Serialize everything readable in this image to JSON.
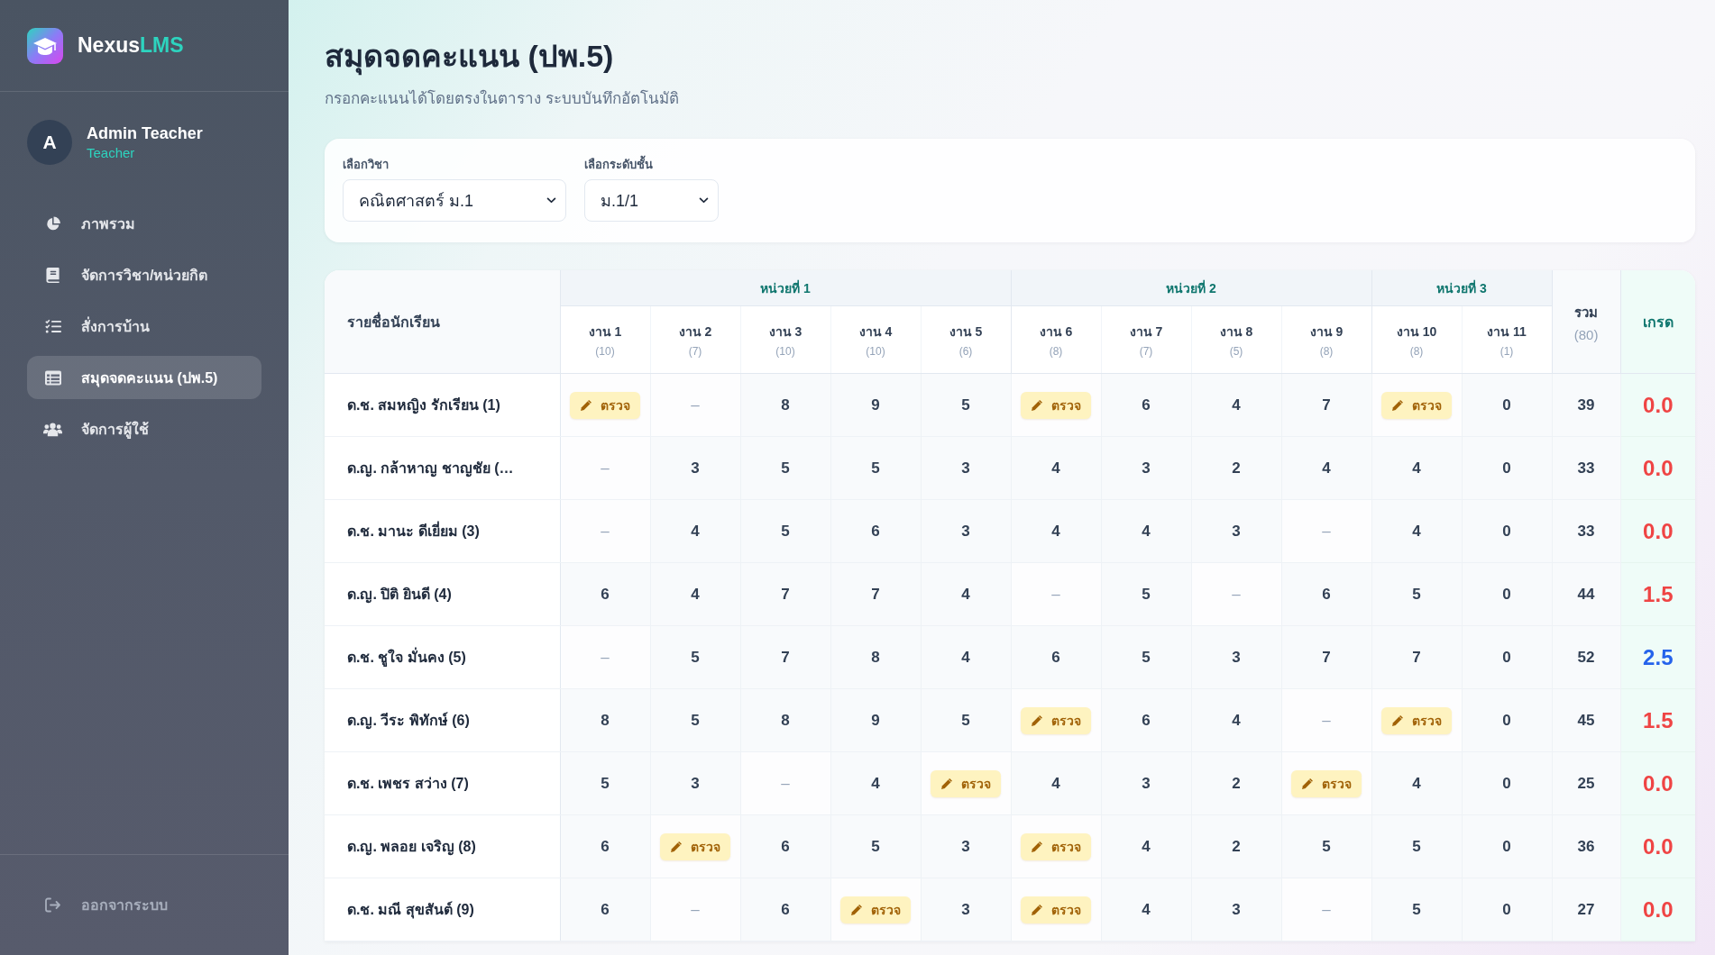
{
  "sidebar": {
    "brand": {
      "name": "Nexus",
      "accent": "LMS"
    },
    "user": {
      "initial": "A",
      "name": "Admin Teacher",
      "role": "Teacher"
    },
    "nav": [
      {
        "label": "ภาพรวม",
        "selected": false
      },
      {
        "label": "จัดการวิชา/หน่วยกิต",
        "selected": false
      },
      {
        "label": "สั่งการบ้าน",
        "selected": false
      },
      {
        "label": "สมุดจดคะแนน (ปพ.5)",
        "selected": true
      },
      {
        "label": "จัดการผู้ใช้",
        "selected": false
      }
    ],
    "logout": "ออกจากระบบ"
  },
  "header": {
    "title": "สมุดจดคะแนน (ปพ.5)",
    "subtitle": "กรอกคะแนนได้โดยตรงในตาราง ระบบบันทึกอัตโนมัติ"
  },
  "filters": [
    {
      "label": "เลือกวิชา",
      "value": "คณิตศาสตร์ ม.1"
    },
    {
      "label": "เลือกระดับชั้น",
      "value": "ม.1/1"
    }
  ],
  "table": {
    "student_header": "รายชื่อนักเรียน",
    "units": [
      {
        "label": "หน่วยที่ 1",
        "tasks": [
          {
            "label": "งาน 1",
            "max": "(10)"
          },
          {
            "label": "งาน 2",
            "max": "(7)"
          },
          {
            "label": "งาน 3",
            "max": "(10)"
          },
          {
            "label": "งาน 4",
            "max": "(10)"
          },
          {
            "label": "งาน 5",
            "max": "(6)"
          }
        ]
      },
      {
        "label": "หน่วยที่ 2",
        "tasks": [
          {
            "label": "งาน 6",
            "max": "(8)"
          },
          {
            "label": "งาน 7",
            "max": "(7)"
          },
          {
            "label": "งาน 8",
            "max": "(5)"
          },
          {
            "label": "งาน 9",
            "max": "(8)"
          }
        ]
      },
      {
        "label": "หน่วยที่ 3",
        "tasks": [
          {
            "label": "งาน 10",
            "max": "(8)"
          },
          {
            "label": "งาน 11",
            "max": "(1)"
          }
        ]
      }
    ],
    "total_header": {
      "label": "รวม",
      "max": "(80)"
    },
    "grade_header": "เกรด",
    "rows": [
      {
        "name": "ด.ช. สมหญิง รักเรียน (1)",
        "cells": [
          {
            "kind": "pending",
            "text": "ตรวจ"
          },
          {
            "kind": "missing",
            "text": "–"
          },
          {
            "kind": "score",
            "text": "8"
          },
          {
            "kind": "score",
            "text": "9"
          },
          {
            "kind": "score",
            "text": "5"
          },
          {
            "kind": "pending",
            "text": "ตรวจ"
          },
          {
            "kind": "score",
            "text": "6"
          },
          {
            "kind": "score",
            "text": "4"
          },
          {
            "kind": "score",
            "text": "7"
          },
          {
            "kind": "pending",
            "text": "ตรวจ"
          },
          {
            "kind": "score",
            "text": "0"
          }
        ],
        "total": "39",
        "grade": {
          "text": "0.0",
          "color": "#ef4444"
        }
      },
      {
        "name": "ด.ญ. กล้าหาญ ชาญชัย (…",
        "cells": [
          {
            "kind": "missing",
            "text": "–"
          },
          {
            "kind": "score",
            "text": "3"
          },
          {
            "kind": "score",
            "text": "5"
          },
          {
            "kind": "score",
            "text": "5"
          },
          {
            "kind": "score",
            "text": "3"
          },
          {
            "kind": "score",
            "text": "4"
          },
          {
            "kind": "score",
            "text": "3"
          },
          {
            "kind": "score",
            "text": "2"
          },
          {
            "kind": "score",
            "text": "4"
          },
          {
            "kind": "score",
            "text": "4"
          },
          {
            "kind": "score",
            "text": "0"
          }
        ],
        "total": "33",
        "grade": {
          "text": "0.0",
          "color": "#ef4444"
        }
      },
      {
        "name": "ด.ช. มานะ ดีเยี่ยม (3)",
        "cells": [
          {
            "kind": "missing",
            "text": "–"
          },
          {
            "kind": "score",
            "text": "4"
          },
          {
            "kind": "score",
            "text": "5"
          },
          {
            "kind": "score",
            "text": "6"
          },
          {
            "kind": "score",
            "text": "3"
          },
          {
            "kind": "score",
            "text": "4"
          },
          {
            "kind": "score",
            "text": "4"
          },
          {
            "kind": "score",
            "text": "3"
          },
          {
            "kind": "missing",
            "text": "–"
          },
          {
            "kind": "score",
            "text": "4"
          },
          {
            "kind": "score",
            "text": "0"
          }
        ],
        "total": "33",
        "grade": {
          "text": "0.0",
          "color": "#ef4444"
        }
      },
      {
        "name": "ด.ญ. ปิติ ยินดี (4)",
        "cells": [
          {
            "kind": "score",
            "text": "6"
          },
          {
            "kind": "score",
            "text": "4"
          },
          {
            "kind": "score",
            "text": "7"
          },
          {
            "kind": "score",
            "text": "7"
          },
          {
            "kind": "score",
            "text": "4"
          },
          {
            "kind": "missing",
            "text": "–"
          },
          {
            "kind": "score",
            "text": "5"
          },
          {
            "kind": "missing",
            "text": "–"
          },
          {
            "kind": "score",
            "text": "6"
          },
          {
            "kind": "score",
            "text": "5"
          },
          {
            "kind": "score",
            "text": "0"
          }
        ],
        "total": "44",
        "grade": {
          "text": "1.5",
          "color": "#ef4444"
        }
      },
      {
        "name": "ด.ช. ชูใจ มั่นคง (5)",
        "cells": [
          {
            "kind": "missing",
            "text": "–"
          },
          {
            "kind": "score",
            "text": "5"
          },
          {
            "kind": "score",
            "text": "7"
          },
          {
            "kind": "score",
            "text": "8"
          },
          {
            "kind": "score",
            "text": "4"
          },
          {
            "kind": "score",
            "text": "6"
          },
          {
            "kind": "score",
            "text": "5"
          },
          {
            "kind": "score",
            "text": "3"
          },
          {
            "kind": "score",
            "text": "7"
          },
          {
            "kind": "score",
            "text": "7"
          },
          {
            "kind": "score",
            "text": "0"
          }
        ],
        "total": "52",
        "grade": {
          "text": "2.5",
          "color": "#2563eb"
        }
      },
      {
        "name": "ด.ญ. วีระ พิทักษ์ (6)",
        "cells": [
          {
            "kind": "score",
            "text": "8"
          },
          {
            "kind": "score",
            "text": "5"
          },
          {
            "kind": "score",
            "text": "8"
          },
          {
            "kind": "score",
            "text": "9"
          },
          {
            "kind": "score",
            "text": "5"
          },
          {
            "kind": "pending",
            "text": "ตรวจ"
          },
          {
            "kind": "score",
            "text": "6"
          },
          {
            "kind": "score",
            "text": "4"
          },
          {
            "kind": "missing",
            "text": "–"
          },
          {
            "kind": "pending",
            "text": "ตรวจ"
          },
          {
            "kind": "score",
            "text": "0"
          }
        ],
        "total": "45",
        "grade": {
          "text": "1.5",
          "color": "#ef4444"
        }
      },
      {
        "name": "ด.ช. เพชร สว่าง (7)",
        "cells": [
          {
            "kind": "score",
            "text": "5"
          },
          {
            "kind": "score",
            "text": "3"
          },
          {
            "kind": "missing",
            "text": "–"
          },
          {
            "kind": "score",
            "text": "4"
          },
          {
            "kind": "pending",
            "text": "ตรวจ"
          },
          {
            "kind": "score",
            "text": "4"
          },
          {
            "kind": "score",
            "text": "3"
          },
          {
            "kind": "score",
            "text": "2"
          },
          {
            "kind": "pending",
            "text": "ตรวจ"
          },
          {
            "kind": "score",
            "text": "4"
          },
          {
            "kind": "score",
            "text": "0"
          }
        ],
        "total": "25",
        "grade": {
          "text": "0.0",
          "color": "#ef4444"
        }
      },
      {
        "name": "ด.ญ. พลอย เจริญ (8)",
        "cells": [
          {
            "kind": "score",
            "text": "6"
          },
          {
            "kind": "pending",
            "text": "ตรวจ"
          },
          {
            "kind": "score",
            "text": "6"
          },
          {
            "kind": "score",
            "text": "5"
          },
          {
            "kind": "score",
            "text": "3"
          },
          {
            "kind": "pending",
            "text": "ตรวจ"
          },
          {
            "kind": "score",
            "text": "4"
          },
          {
            "kind": "score",
            "text": "2"
          },
          {
            "kind": "score",
            "text": "5"
          },
          {
            "kind": "score",
            "text": "5"
          },
          {
            "kind": "score",
            "text": "0"
          }
        ],
        "total": "36",
        "grade": {
          "text": "0.0",
          "color": "#ef4444"
        }
      },
      {
        "name": "ด.ช. มณี สุขสันต์ (9)",
        "cells": [
          {
            "kind": "score",
            "text": "6"
          },
          {
            "kind": "missing",
            "text": "–"
          },
          {
            "kind": "score",
            "text": "6"
          },
          {
            "kind": "pending",
            "text": "ตรวจ"
          },
          {
            "kind": "score",
            "text": "3"
          },
          {
            "kind": "pending",
            "text": "ตรวจ"
          },
          {
            "kind": "score",
            "text": "4"
          },
          {
            "kind": "score",
            "text": "3"
          },
          {
            "kind": "missing",
            "text": "–"
          },
          {
            "kind": "score",
            "text": "5"
          },
          {
            "kind": "score",
            "text": "0"
          }
        ],
        "total": "27",
        "grade": {
          "text": "0.0",
          "color": "#ef4444"
        }
      }
    ]
  }
}
